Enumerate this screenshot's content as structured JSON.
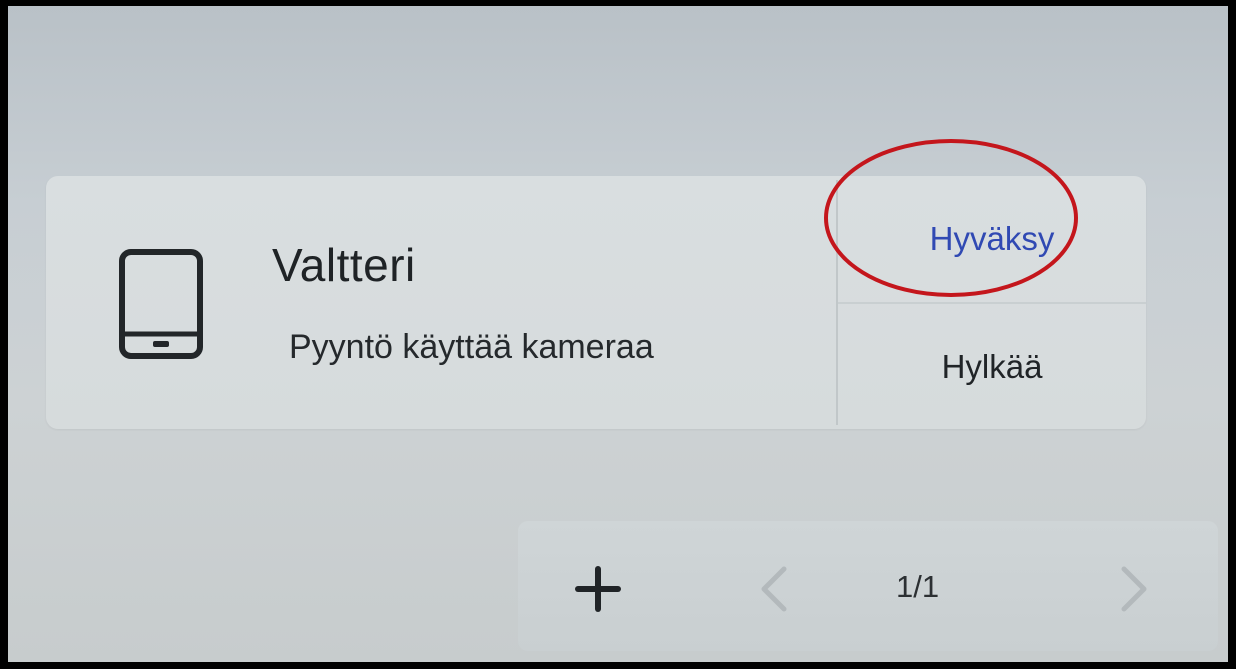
{
  "request_card": {
    "device_icon": "tablet-icon",
    "requester_name": "Valtteri",
    "request_text": "Pyyntö käyttää kameraa",
    "approve_label": "Hyväksy",
    "reject_label": "Hylkää",
    "approve_color": "#3049b3",
    "highlight_color": "#c4161c"
  },
  "pager": {
    "add_icon": "plus-icon",
    "prev_icon": "chevron-left-icon",
    "page_indicator": "1/1",
    "next_icon": "chevron-right-icon"
  }
}
